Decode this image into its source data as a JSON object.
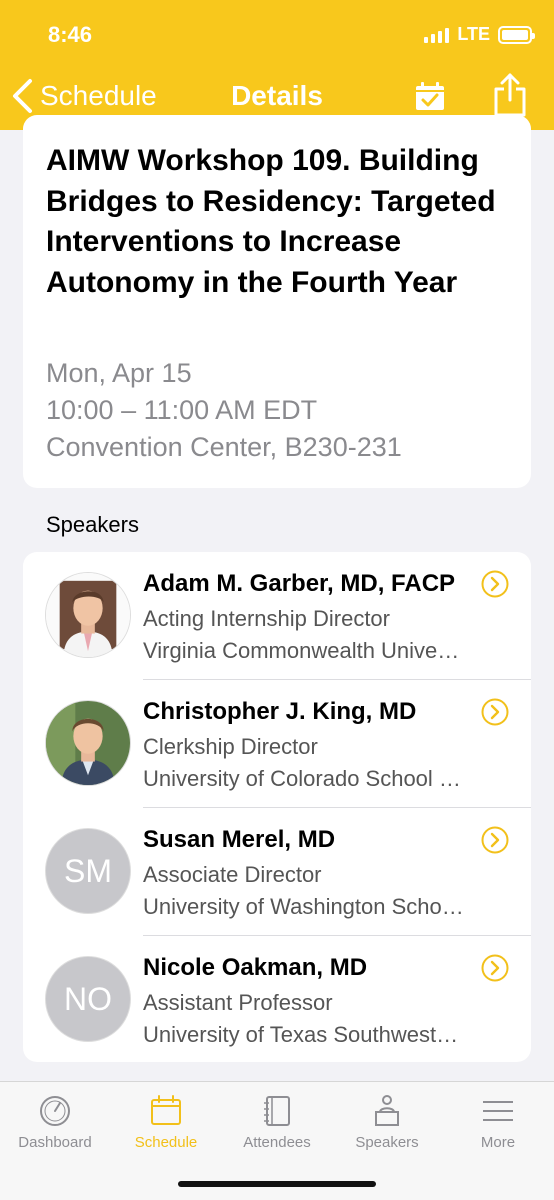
{
  "status_bar": {
    "time": "8:46",
    "network": "LTE",
    "battery_level": 1.0
  },
  "nav": {
    "back_label": "Schedule",
    "title": "Details",
    "icons": [
      "chevron-left-icon",
      "calendar-check-icon",
      "share-icon"
    ]
  },
  "session": {
    "title": "AIMW Workshop 109. Building Bridges to Residency: Targeted Interventions to Increase Autonomy in the Fourth Year",
    "date": "Mon, Apr 15",
    "time": "10:00 – 11:00 AM EDT",
    "location": "Convention Center, B230-231"
  },
  "speakers_section": {
    "label": "Speakers",
    "items": [
      {
        "name": "Adam M. Garber, MD, FACP",
        "role": "Acting Internship Director",
        "org": "Virginia Commonwealth University",
        "avatar": "photo",
        "initials": ""
      },
      {
        "name": "Christopher J. King, MD",
        "role": "Clerkship Director",
        "org": "University of Colorado School of Medicine",
        "avatar": "photo",
        "initials": ""
      },
      {
        "name": "Susan Merel, MD",
        "role": "Associate Director",
        "org": "University of Washington School of Medicine",
        "avatar": "initials",
        "initials": "SM"
      },
      {
        "name": "Nicole Oakman, MD",
        "role": "Assistant Professor",
        "org": "University of Texas Southwestern",
        "avatar": "initials",
        "initials": "NO"
      }
    ]
  },
  "tab_bar": {
    "active": "Schedule",
    "tabs": [
      {
        "label": "Dashboard",
        "icon": "gauge-icon"
      },
      {
        "label": "Schedule",
        "icon": "calendar-icon"
      },
      {
        "label": "Attendees",
        "icon": "notebook-icon"
      },
      {
        "label": "Speakers",
        "icon": "podium-icon"
      },
      {
        "label": "More",
        "icon": "menu-icon"
      }
    ]
  },
  "colors": {
    "accent": "#f8c81c",
    "background": "#f2f2f6",
    "secondary_text": "#8a8a8e"
  }
}
